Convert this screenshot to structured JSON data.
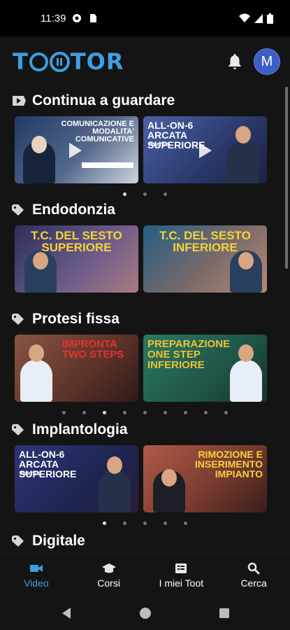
{
  "status": {
    "time": "11:39"
  },
  "app": {
    "logo_text": "TOOTOR",
    "avatar_letter": "M"
  },
  "sections": [
    {
      "title": "Continua a guardare",
      "cards": [
        {
          "caption": "COMUNICAZIONE E MODALITA' COMUNICATIVE",
          "bg": "#3a4e6e",
          "accent": "#ffffff"
        },
        {
          "caption": "ALL-ON-6 ARCATA SUPERIORE",
          "sub": "PARTE 1",
          "bg": "#3b4f86",
          "accent": "#ffffff"
        }
      ],
      "dots": 3,
      "active_dot": 0
    },
    {
      "title": "Endodonzia",
      "cards": [
        {
          "caption": "T.C. DEL SESTO SUPERIORE",
          "bg": "#4e4770",
          "accent": "#f5d33a"
        },
        {
          "caption": "T.C. DEL SESTO INFERIORE",
          "bg": "#2f5f8a",
          "accent": "#f5d33a"
        }
      ],
      "dots": 0,
      "active_dot": -1
    },
    {
      "title": "Protesi fissa",
      "cards": [
        {
          "caption": "IMPRONTA TWO STEPS",
          "bg": "#7a4032",
          "accent": "#e6322c"
        },
        {
          "caption": "PREPARAZIONE ONE STEP INFERIORE",
          "bg": "#2f6e5a",
          "accent": "#f2c034"
        }
      ],
      "dots": 9,
      "active_dot": 2
    },
    {
      "title": "Implantologia",
      "cards": [
        {
          "caption": "ALL-ON-6 ARCATA SUPERIORE",
          "sub": "PARTE 2",
          "bg": "#3a3d78",
          "accent": "#ffffff"
        },
        {
          "caption": "RIMOZIONE E INSERIMENTO IMPIANTO",
          "bg": "#8a4a3c",
          "accent": "#f5d33a"
        }
      ],
      "dots": 5,
      "active_dot": 0
    },
    {
      "title": "Digitale",
      "cards": [],
      "dots": 0,
      "active_dot": -1
    }
  ],
  "nav": [
    {
      "label": "Video",
      "icon": "video-camera-icon",
      "active": true
    },
    {
      "label": "Corsi",
      "icon": "graduation-cap-icon",
      "active": false
    },
    {
      "label": "I miei Toot",
      "icon": "list-icon",
      "active": false
    },
    {
      "label": "Cerca",
      "icon": "search-icon",
      "active": false
    }
  ],
  "colors": {
    "accent": "#3e9fe0",
    "avatar": "#3f5dc6",
    "background": "#141414"
  }
}
